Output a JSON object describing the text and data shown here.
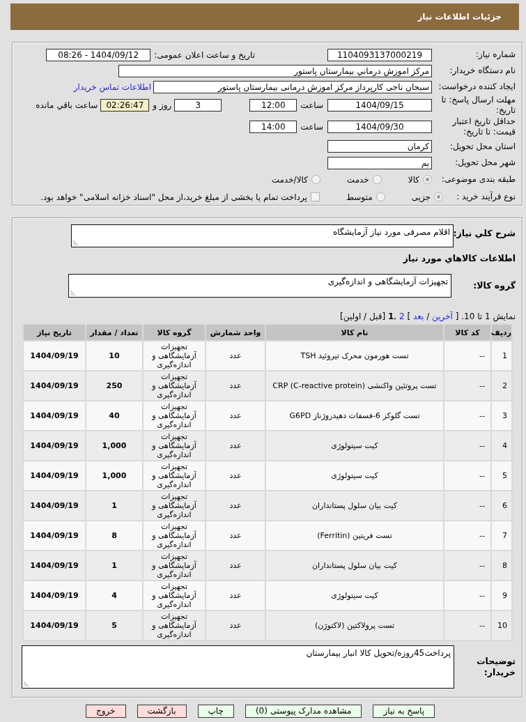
{
  "header": {
    "title": "جزئیات اطلاعات نیاز"
  },
  "details": {
    "need_number": {
      "label": "شماره نیاز:",
      "value": "1104093137000219"
    },
    "announce": {
      "label": "تاریخ و ساعت اعلان عمومی:",
      "value": "1404/09/12 - 08:26"
    },
    "buyer_org": {
      "label": "نام دستگاه خریدار:",
      "value": "مرکز اموزش درماني بيمارستان پاستور"
    },
    "requester": {
      "label": "ایجاد کننده درخواست:",
      "value": "سبحان ناجی کارپرداز مرکز اموزش درمانی بیمارستان پاستور",
      "link": "اطلاعات تماس خریدار"
    },
    "deadline": {
      "label": "مهلت ارسال پاسخ: تا تاریخ:",
      "date": "1404/09/15",
      "time_label": "ساعت",
      "time": "12:00",
      "days": "3",
      "days_label": "روز و",
      "remaining": "02:26:47",
      "remaining_label": "ساعت باقي مانده"
    },
    "validity": {
      "label": "حداقل تاریخ اعتبار قیمت: تا تاریخ:",
      "date": "1404/09/30",
      "time_label": "ساعت",
      "time": "14:00"
    },
    "province": {
      "label": "استان محل تحویل:",
      "value": "کرمان"
    },
    "city": {
      "label": "شهر محل تحویل:",
      "value": "بم"
    },
    "category": {
      "label": "طبقه بندی موضوعی:",
      "options": [
        {
          "label": "کالا",
          "selected": true,
          "disabled": true
        },
        {
          "label": "خدمت",
          "selected": false,
          "disabled": true
        },
        {
          "label": "کالا/خدمت",
          "selected": false,
          "disabled": true
        }
      ]
    },
    "process": {
      "label": "نوع فرآیند خرید :",
      "options": [
        {
          "label": "جزیی",
          "selected": true,
          "disabled": true
        },
        {
          "label": "متوسط",
          "selected": false,
          "disabled": true
        }
      ],
      "treasury": {
        "label": "پرداخت تمام یا بخشی از مبلغ خرید،از محل \"اسناد خزانه اسلامی\" خواهد بود.",
        "checked": false,
        "disabled": true
      }
    }
  },
  "summary": {
    "label": "شرح كلي نياز:",
    "value": "اقلام مصرفی مورد نیاز آزمایشگاه"
  },
  "goods_heading": "اطلاعات کالاهاي مورد نياز",
  "goods_group": {
    "label": "گروه کالا:",
    "value": "تجهیزات آزمایشگاهی و اندازه‌گیری"
  },
  "pagination": [
    {
      "kind": "text",
      "text": "نمایش 1 تا 10. ["
    },
    {
      "kind": "link",
      "text": "آخرین"
    },
    {
      "kind": "text",
      "text": "/"
    },
    {
      "kind": "link",
      "text": "بعد"
    },
    {
      "kind": "text",
      "text": "]"
    },
    {
      "kind": "link",
      "text": "2"
    },
    {
      "kind": "text",
      "text": ","
    },
    {
      "kind": "current",
      "text": "1"
    },
    {
      "kind": "text",
      "text": "[قبل / اولین]"
    }
  ],
  "table": {
    "columns": [
      "ردیف",
      "کد کالا",
      "نام کالا",
      "واحد شمارش",
      "گروه کالا",
      "تعداد / مقدار",
      "تاریخ نیاز"
    ],
    "rows": [
      {
        "row": "1",
        "code": "--",
        "name": "تست هورمون محرک تیروئید TSH",
        "unit": "عدد",
        "group": "تجهیزات آزمایشگاهی و اندازه‌گیری",
        "quantity": "10",
        "date": "1404/09/19"
      },
      {
        "row": "2",
        "code": "--",
        "name": "تست پروتئین واکنشی (CRP (C-reactive protein",
        "unit": "عدد",
        "group": "تجهیزات آزمایشگاهی و اندازه‌گیری",
        "quantity": "250",
        "date": "1404/09/19"
      },
      {
        "row": "3",
        "code": "--",
        "name": "تست گلوکز 6-فسفات دهیدروژناز G6PD",
        "unit": "عدد",
        "group": "تجهیزات آزمایشگاهی و اندازه‌گیری",
        "quantity": "40",
        "date": "1404/09/19"
      },
      {
        "row": "4",
        "code": "--",
        "name": "کیت سیتولوژی",
        "unit": "عدد",
        "group": "تجهیزات آزمایشگاهی و اندازه‌گیری",
        "quantity": "1,000",
        "date": "1404/09/19"
      },
      {
        "row": "5",
        "code": "--",
        "name": "کیت سیتولوژی",
        "unit": "عدد",
        "group": "تجهیزات آزمایشگاهی و اندازه‌گیری",
        "quantity": "1,000",
        "date": "1404/09/19"
      },
      {
        "row": "6",
        "code": "--",
        "name": "کیت بیان سلول پستانداران",
        "unit": "عدد",
        "group": "تجهیزات آزمایشگاهی و اندازه‌گیری",
        "quantity": "1",
        "date": "1404/09/19"
      },
      {
        "row": "7",
        "code": "--",
        "name": "تست فریتین (Ferritin)",
        "unit": "عدد",
        "group": "تجهیزات آزمایشگاهی و اندازه‌گیری",
        "quantity": "8",
        "date": "1404/09/19"
      },
      {
        "row": "8",
        "code": "--",
        "name": "کیت بیان سلول پستانداران",
        "unit": "عدد",
        "group": "تجهیزات آزمایشگاهی و اندازه‌گیری",
        "quantity": "1",
        "date": "1404/09/19"
      },
      {
        "row": "9",
        "code": "--",
        "name": "کیت سیتولوژی",
        "unit": "عدد",
        "group": "تجهیزات آزمایشگاهی و اندازه‌گیری",
        "quantity": "4",
        "date": "1404/09/19"
      },
      {
        "row": "10",
        "code": "--",
        "name": "تست پرولاکتین (لاکتوژن)",
        "unit": "عدد",
        "group": "تجهیزات آزمایشگاهی و اندازه‌گیری",
        "quantity": "5",
        "date": "1404/09/19"
      }
    ]
  },
  "buyer_notes": {
    "label": "توضیحات خریدار:",
    "value": "پرداخت45روزه/تحویل کالا انبار بیمارستان"
  },
  "buttons": [
    {
      "label": "پاسخ به نیاز",
      "kind": "action"
    },
    {
      "label": "مشاهده مدارک پیوستی (0)",
      "kind": "action"
    },
    {
      "label": "چاپ",
      "kind": "action"
    },
    {
      "label": "بازگشت",
      "kind": "exit"
    },
    {
      "label": "خروج",
      "kind": "exit"
    }
  ]
}
